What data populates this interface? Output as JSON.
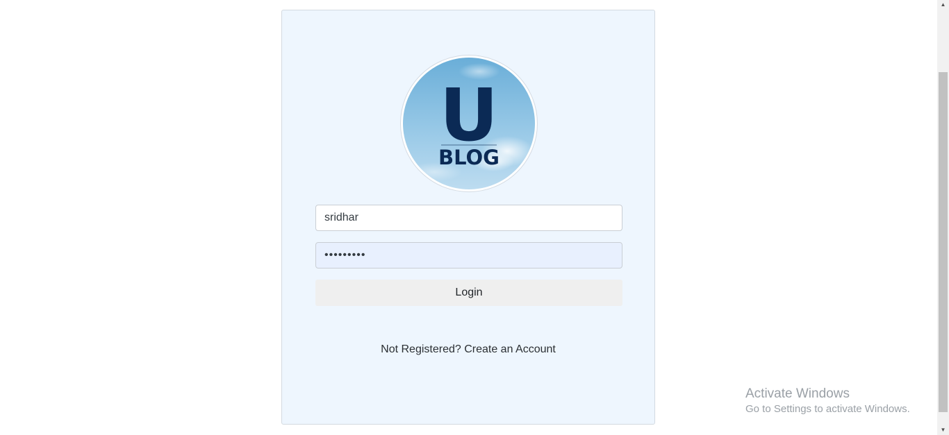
{
  "login": {
    "logo": {
      "letter": "U",
      "word": "BLOG",
      "colors": {
        "sky_top": "#6fb0d8",
        "sky_bottom": "#b9d9ee",
        "navy": "#0b2a55"
      }
    },
    "username_value": "sridhar",
    "password_display": "•••••••••",
    "login_button_label": "Login",
    "register_link_text": "Not Registered? Create an Account"
  },
  "watermark": {
    "title": "Activate Windows",
    "subtitle": "Go to Settings to activate Windows."
  },
  "scrollbar": {
    "up_icon": "▲",
    "down_icon": "▼"
  },
  "colors": {
    "card_background": "#eef6fe",
    "password_autofill_background": "#e8f0fe",
    "button_background": "#efefef"
  }
}
